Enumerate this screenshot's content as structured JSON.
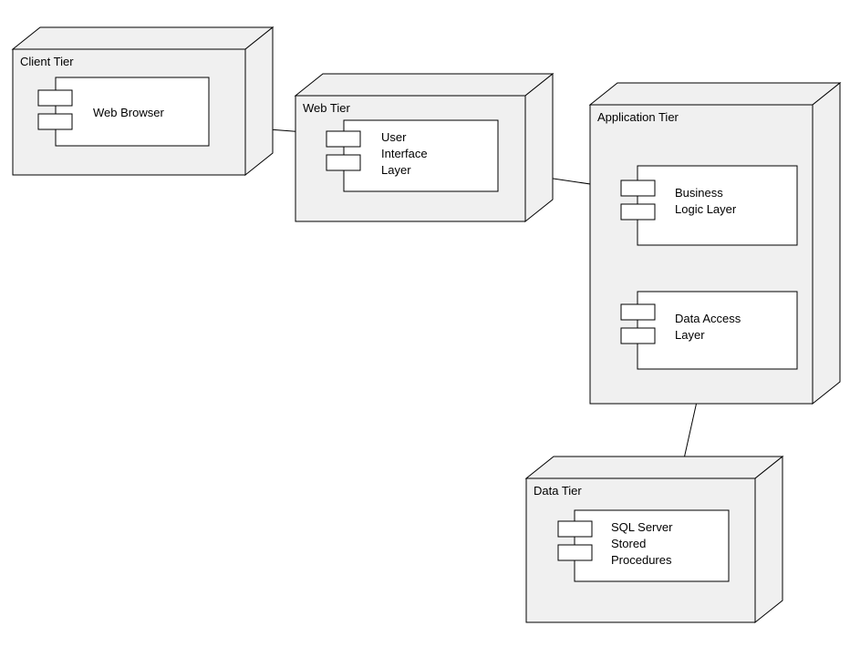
{
  "tiers": {
    "client": {
      "label": "Client Tier",
      "components": {
        "webBrowser": {
          "label": "Web Browser"
        }
      }
    },
    "web": {
      "label": "Web Tier",
      "components": {
        "uiLayer": {
          "line1": "User",
          "line2": "Interface",
          "line3": "Layer"
        }
      }
    },
    "application": {
      "label": "Application Tier",
      "components": {
        "bizLogic": {
          "line1": "Business",
          "line2": "Logic Layer"
        },
        "dataAccess": {
          "line1": "Data Access",
          "line2": "Layer"
        }
      }
    },
    "data": {
      "label": "Data Tier",
      "components": {
        "sql": {
          "line1": "SQL Server",
          "line2": "Stored",
          "line3": "Procedures"
        }
      }
    }
  }
}
